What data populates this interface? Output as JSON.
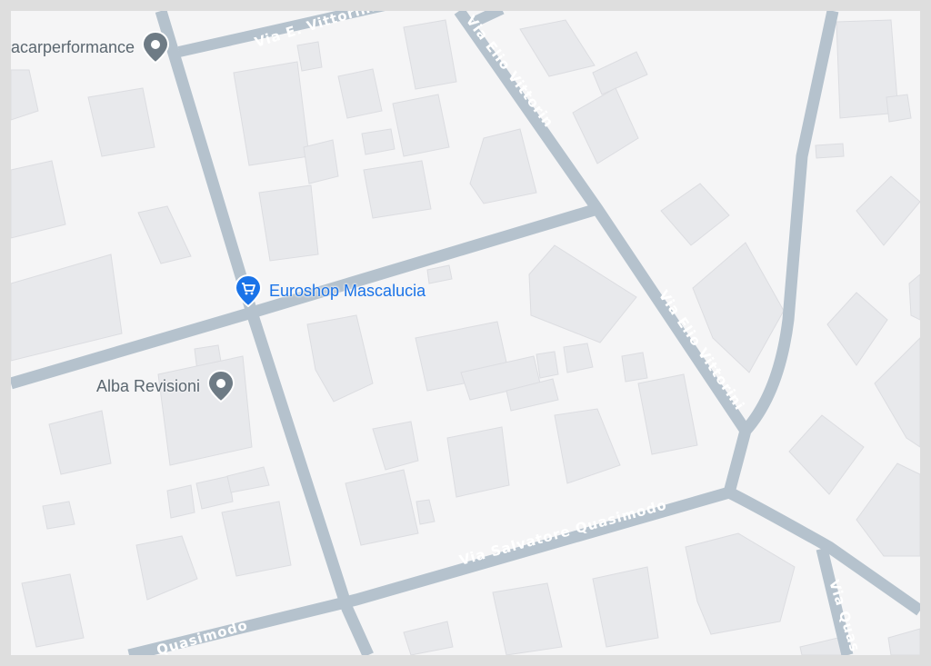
{
  "map": {
    "background": "#f5f5f6",
    "frame_color": "#dedede",
    "road_color": "#b5c2cd",
    "building_color": "#e8e9ec",
    "building_stroke": "#dcdde1",
    "road_label_color": "#ffffff"
  },
  "road_labels": {
    "via_e_vittorini_top": "Via E. Vittorini",
    "via_elio_vittorini_upper": "Via Elio Vittorini",
    "via_elio_vittorini_lower": "Via Elio Vittorini",
    "via_salvatore_quasimodo": "Via Salvatore Quasimodo",
    "quasimodo_left": "Quasimodo",
    "via_quasimodo_right": "Via Quasimodo"
  },
  "pois": [
    {
      "label": "acarperformance",
      "icon": "location-pin-icon",
      "color": "#5b6770"
    },
    {
      "label": "Euroshop Mascalucia",
      "icon": "shopping-cart-icon",
      "color": "#1a73e8"
    },
    {
      "label": "Alba Revisioni",
      "icon": "location-pin-icon",
      "color": "#5b6770"
    }
  ]
}
